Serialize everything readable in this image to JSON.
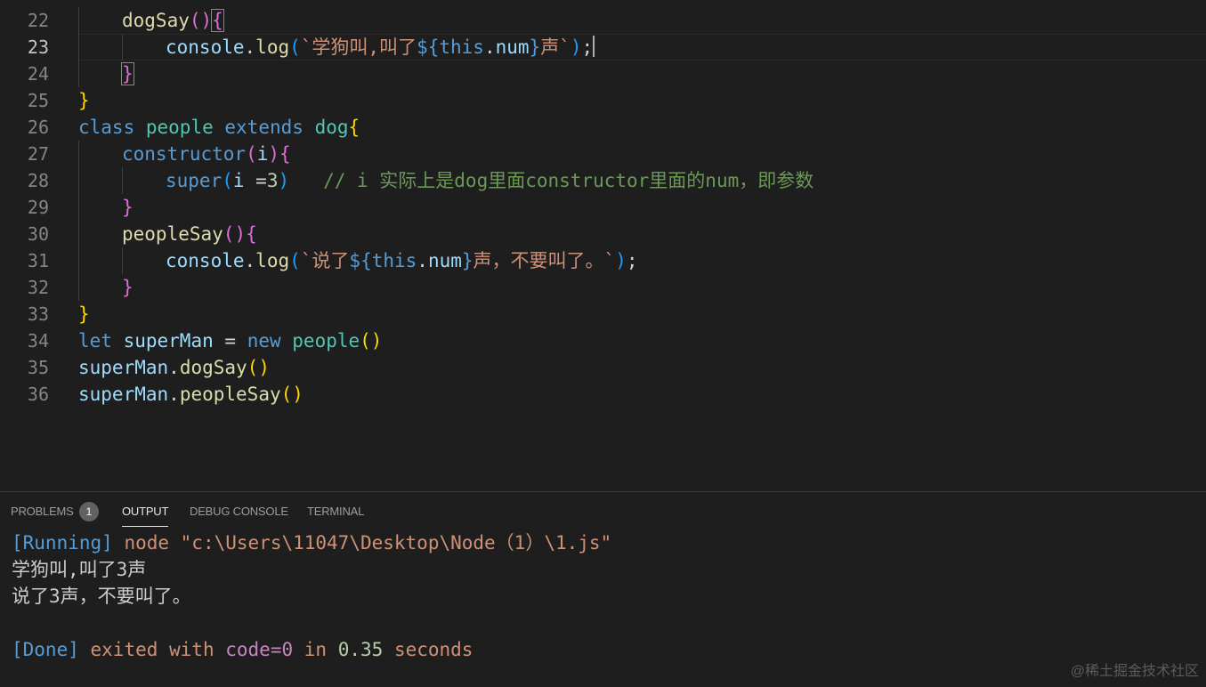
{
  "editor": {
    "lines": [
      {
        "n": "22",
        "t1": "dogSay",
        "t2": "(",
        "t3": ")",
        "t4": "{"
      },
      {
        "n": "23",
        "t1": "console",
        "t2": ".",
        "t3": "log",
        "t4": "(",
        "t5": "`学狗叫,叫了",
        "t6": "${",
        "t7": "this",
        "t8": ".",
        "t9": "num",
        "t10": "}",
        "t11": "声`",
        "t12": ")",
        "t13": ";"
      },
      {
        "n": "24",
        "t1": "}"
      },
      {
        "n": "25",
        "t1": "}"
      },
      {
        "n": "26",
        "t1": "class",
        "t2": "people",
        "t3": "extends",
        "t4": "dog",
        "t5": "{"
      },
      {
        "n": "27",
        "t1": "constructor",
        "t2": "(",
        "t3": "i",
        "t4": ")",
        "t5": "{"
      },
      {
        "n": "28",
        "t1": "super",
        "t2": "(",
        "t3": "i",
        "t4": " =",
        "t5": "3",
        "t6": ")",
        "t7": "// i 实际上是dog里面constructor里面的num，即参数"
      },
      {
        "n": "29",
        "t1": "}"
      },
      {
        "n": "30",
        "t1": "peopleSay",
        "t2": "(",
        "t3": ")",
        "t4": "{"
      },
      {
        "n": "31",
        "t1": "console",
        "t2": ".",
        "t3": "log",
        "t4": "(",
        "t5": "`说了",
        "t6": "${",
        "t7": "this",
        "t8": ".",
        "t9": "num",
        "t10": "}",
        "t11": "声，不要叫了。`",
        "t12": ")",
        "t13": ";"
      },
      {
        "n": "32",
        "t1": "}"
      },
      {
        "n": "33",
        "t1": "}"
      },
      {
        "n": "34",
        "t1": "let",
        "t2": "superMan",
        "t3": " = ",
        "t4": "new",
        "t5": "people",
        "t6": "(",
        "t7": ")"
      },
      {
        "n": "35",
        "t1": "superMan",
        "t2": ".",
        "t3": "dogSay",
        "t4": "(",
        "t5": ")"
      },
      {
        "n": "36",
        "t1": "superMan",
        "t2": ".",
        "t3": "peopleSay",
        "t4": "(",
        "t5": ")"
      }
    ]
  },
  "panel": {
    "tabs": {
      "problems": "PROBLEMS",
      "problems_count": "1",
      "output": "OUTPUT",
      "debug": "DEBUG CONSOLE",
      "terminal": "TERMINAL"
    },
    "output": {
      "run_tag": "[Running]",
      "run_cmd": "node \"c:\\Users\\11047\\Desktop\\Node（1）\\1.js\"",
      "line1": "学狗叫,叫了3声",
      "line2": "说了3声，不要叫了。",
      "done_tag": "[Done]",
      "done_a": "exited with",
      "done_code": "code=0",
      "done_b": "in",
      "done_time": "0.35",
      "done_c": "seconds"
    }
  },
  "watermark": "@稀土掘金技术社区"
}
